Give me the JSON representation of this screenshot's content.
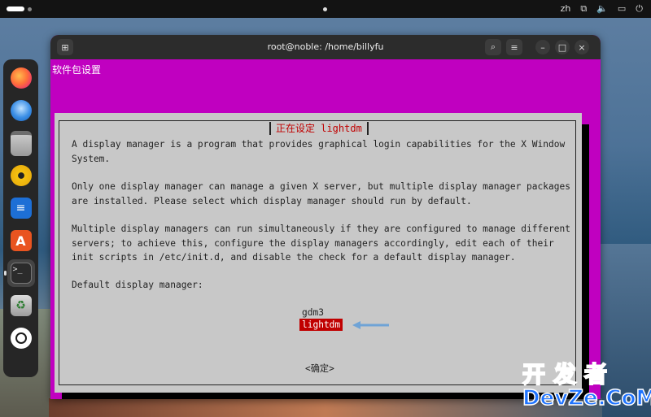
{
  "topbar": {
    "language": "zh",
    "icons": [
      "network-icon",
      "volume-icon",
      "battery-icon",
      "power-icon"
    ]
  },
  "dock": {
    "items": [
      {
        "name": "firefox",
        "icon": "firefox-icon"
      },
      {
        "name": "thunderbird",
        "icon": "thunderbird-icon"
      },
      {
        "name": "files",
        "icon": "files-icon"
      },
      {
        "name": "rhythmbox",
        "icon": "rhythmbox-icon"
      },
      {
        "name": "libreoffice-writer",
        "icon": "writer-icon"
      },
      {
        "name": "app-center",
        "icon": "app-center-icon",
        "glyph": "A"
      },
      {
        "name": "terminal",
        "icon": "terminal-icon",
        "glyph": ">_",
        "active": true
      },
      {
        "name": "trash",
        "icon": "trash-icon",
        "glyph": "♻"
      },
      {
        "name": "show-apps",
        "icon": "ubuntu-icon"
      }
    ]
  },
  "window": {
    "title": "root@noble: /home/billyfu",
    "backtitle": "软件包设置"
  },
  "dialog": {
    "title": "正在设定 lightdm",
    "paragraph1": "A display manager is a program that provides graphical login capabilities for the X Window\nSystem.",
    "paragraph2": "Only one display manager can manage a given X server, but multiple display manager packages\nare installed. Please select which display manager should run by default.",
    "paragraph3": "Multiple display managers can run simultaneously if they are configured to manage different\nservers; to achieve this, configure the display managers accordingly, edit each of their\ninit scripts in /etc/init.d, and disable the check for a default display manager.",
    "paragraph4": "Default display manager:",
    "options": [
      "gdm3",
      "lightdm"
    ],
    "selected": "lightdm",
    "ok_label": "<确定>"
  },
  "watermark": {
    "top": "开发者",
    "bottom": "DevZe.CoM"
  },
  "colors": {
    "terminal_bg": "#c000c0",
    "dialog_bg": "#c8c8c8",
    "selection": "#c00000",
    "arrow": "#6fa3d6"
  }
}
